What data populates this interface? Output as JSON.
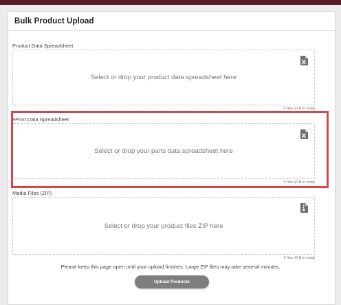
{
  "panel": {
    "title": "Bulk Product Upload"
  },
  "sections": [
    {
      "label": "Product Data Spreadsheet",
      "dropzone_text": "Select or drop your product data spreadsheet here",
      "file_count": "0 files (0 B in total)",
      "icon": "excel-file-icon"
    },
    {
      "label": "ePrint Data Spreadsheet",
      "dropzone_text": "Select or drop your parts data spreadsheet here",
      "file_count": "0 files (0 B in total)",
      "icon": "excel-file-icon"
    },
    {
      "label": "Media Files (ZIP)",
      "dropzone_text": "Select or drop your product files ZIP here",
      "file_count": "0 files (0 B in total)",
      "icon": "zip-file-icon"
    }
  ],
  "notice": "Please keep this page open until your upload finishes. Large ZIP files may take several minutes.",
  "upload_button": "Upload Products",
  "colors": {
    "topbar": "#5c1a26",
    "highlight": "#d9434b",
    "button": "#7e7e7e"
  }
}
